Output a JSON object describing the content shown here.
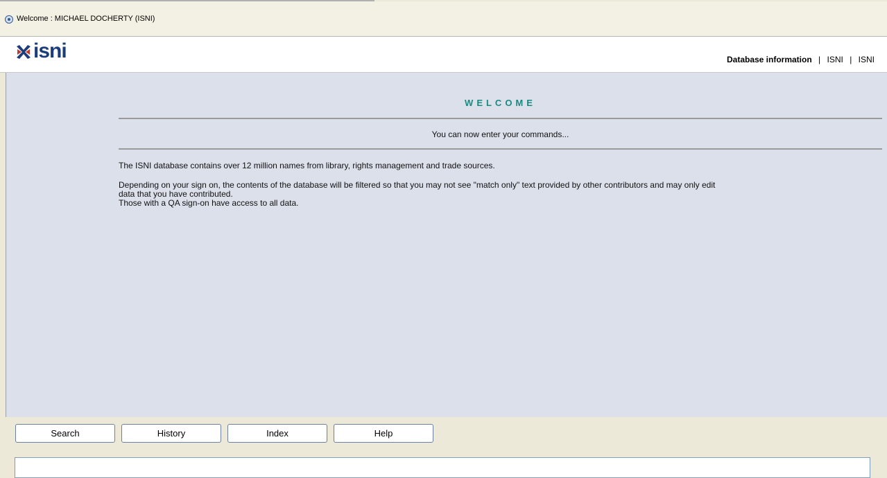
{
  "titlebar": {
    "text": "Welcome : MICHAEL DOCHERTY (ISNI)",
    "icon": "eye-icon"
  },
  "header": {
    "logo_text": "isni",
    "links": [
      {
        "label": "Database information"
      },
      {
        "label": "ISNI"
      },
      {
        "label": "ISNI"
      }
    ],
    "separator": "|"
  },
  "main": {
    "heading": "WELCOME",
    "subheading": "You can now enter your commands...",
    "paragraph1": "The ISNI database contains over 12 million names from library, rights management and trade sources.",
    "paragraph2_line1": "Depending on your sign on, the contents of the database will be filtered so that you may not see \"match only\" text provided by other contributors and may only edit",
    "paragraph2_line2": "data that you have contributed.",
    "paragraph2_line3": "Those with a QA sign-on have access to all data."
  },
  "toolbar": {
    "buttons": [
      {
        "label": "Search"
      },
      {
        "label": "History"
      },
      {
        "label": "Index"
      },
      {
        "label": "Help"
      }
    ]
  },
  "command_input": {
    "value": ""
  },
  "colors": {
    "heading": "#1a8a80",
    "logo": "#1c3d7a",
    "panel": "#dbe0ea"
  }
}
